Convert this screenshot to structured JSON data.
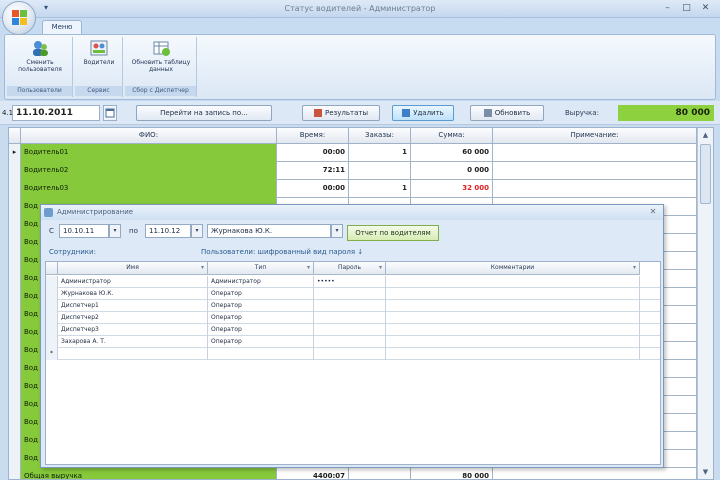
{
  "window": {
    "title": "Статус водителей - Администратор",
    "controls": [
      "–",
      "□",
      "✕"
    ],
    "qat_icon": "dropdown-arrow-icon"
  },
  "ribbon": {
    "tab": "Меню",
    "groups": [
      {
        "name": "Пользователи",
        "buttons": [
          "Сменить пользователя"
        ]
      },
      {
        "name": "Сервис",
        "buttons": [
          "Водители"
        ]
      },
      {
        "name": "Сбор с Диспетчер",
        "buttons": [
          "Обновить таблицу данных"
        ]
      }
    ]
  },
  "toolbar": {
    "date_prefix": "4.1",
    "date": "11.10.2011",
    "filter_button": "Перейти на запись по...",
    "actions": [
      "Результаты",
      "Удалить",
      "Обновить"
    ],
    "revenue_label": "Выручка:",
    "revenue_value": "80 000"
  },
  "grid": {
    "columns": [
      "ФИО:",
      "Время:",
      "Заказы:",
      "Сумма:",
      "Примечание:"
    ],
    "rows": [
      {
        "name": "Водитель01",
        "time": "00:00",
        "orders": "1",
        "sum": "60 000",
        "sum_red": false,
        "marker": "▸"
      },
      {
        "name": "Водитель02",
        "time": "72:11",
        "orders": "",
        "sum": "0 000",
        "sum_red": false,
        "marker": ""
      },
      {
        "name": "Водитель03",
        "time": "00:00",
        "orders": "1",
        "sum": "32 000",
        "sum_red": true,
        "marker": ""
      }
    ],
    "partial_rows": [
      "Вод",
      "Вод",
      "Вод",
      "Вод",
      "Вод",
      "Вод",
      "Вод",
      "Вод",
      "Вод",
      "Вод",
      "Вод",
      "Вод",
      "Вод",
      "Вод",
      "Вод"
    ],
    "total_row": {
      "name": "Общая выручка",
      "time": "4400:07",
      "sum": "80 000"
    }
  },
  "dialog": {
    "title": "Администрирование",
    "from_label": "С",
    "from_date": "10.10.11",
    "to_label": "по",
    "to_date": "11.10.12",
    "user_select": "Журнакова Ю.К.",
    "report_button": "Отчет по водителям",
    "sub_left": "Сотрудники:",
    "sub_right": "Пользователи: шифрованный вид пароля ↓",
    "columns": [
      "Имя",
      "Тип",
      "Пароль",
      "Комментарии"
    ],
    "rows": [
      {
        "name": "Администратор",
        "type": "Администратор",
        "password": "•••••",
        "comment": ""
      },
      {
        "name": "Журнакова Ю.К.",
        "type": "Оператор",
        "password": "",
        "comment": ""
      },
      {
        "name": "Диспетчер1",
        "type": "Оператор",
        "password": "",
        "comment": ""
      },
      {
        "name": "Диспетчер2",
        "type": "Оператор",
        "password": "",
        "comment": ""
      },
      {
        "name": "Диспетчер3",
        "type": "Оператор",
        "password": "",
        "comment": ""
      },
      {
        "name": "Захарова А. Т.",
        "type": "Оператор",
        "password": "",
        "comment": ""
      }
    ],
    "new_row_marker": "*"
  },
  "colors": {
    "green_cell": "#86c93b",
    "revenue_green": "#8ed13f",
    "red_text": "#e02020",
    "ribbon_blue": "#c7dbf1"
  }
}
